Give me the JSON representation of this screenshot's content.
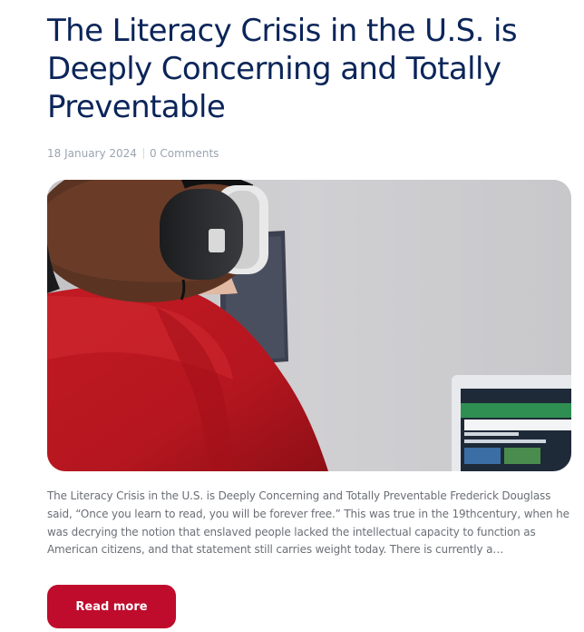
{
  "post": {
    "title": "The Literacy Crisis in the U.S. is Deeply Concerning and Totally Preventable",
    "date": "18 January 2024",
    "comments": "0 Comments",
    "excerpt": "The Literacy Crisis in the U.S. is Deeply Concerning and Totally Preventable Frederick Douglass said, “Once you learn to read, you will be forever free.” This was true in the 19thcentury, when he was decrying the notion that enslaved people lacked the intellectual capacity to function as American citizens, and that statement still carries weight today.  There is currently a…",
    "read_more_label": "Read more",
    "image": {
      "subject": "boy-with-headphones-at-laptop-photo",
      "laptop_screen_text": "List the similarities and differences between two images"
    }
  },
  "colors": {
    "title": "#0b2559",
    "meta": "#9aa4b0",
    "body_text": "#6b6f76",
    "button": "#bf0b2c",
    "button_text": "#ffffff"
  }
}
